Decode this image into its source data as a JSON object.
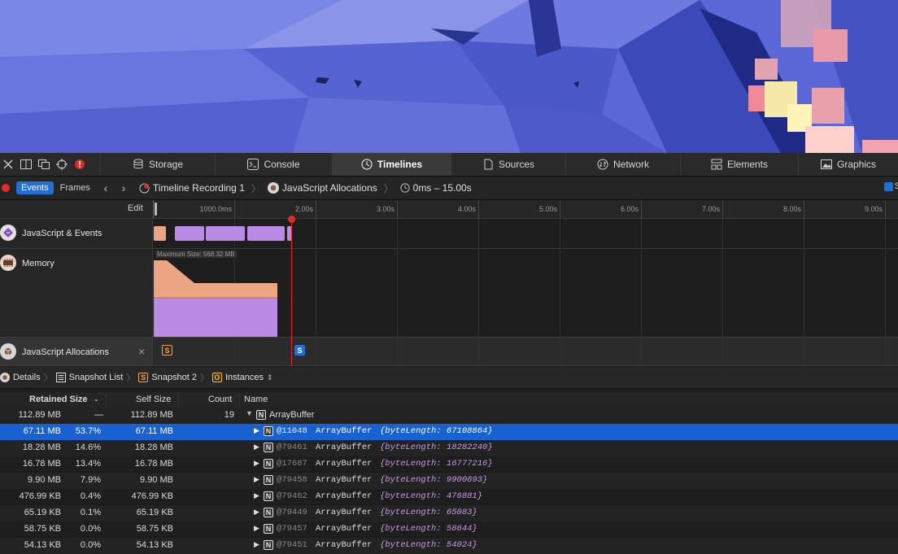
{
  "tabs": [
    {
      "label": "Storage",
      "icon": "storage-icon",
      "active": false
    },
    {
      "label": "Console",
      "icon": "console-icon",
      "active": false
    },
    {
      "label": "Timelines",
      "icon": "timelines-icon",
      "active": true
    },
    {
      "label": "Sources",
      "icon": "sources-icon",
      "active": false
    },
    {
      "label": "Network",
      "icon": "network-icon",
      "active": false
    },
    {
      "label": "Elements",
      "icon": "elements-icon",
      "active": false
    },
    {
      "label": "Graphics",
      "icon": "graphics-icon",
      "active": false
    }
  ],
  "nav": {
    "events": "Events",
    "frames": "Frames",
    "recording": "Timeline Recording 1",
    "instrument": "JavaScript Allocations",
    "range": "0ms – 15.00s",
    "checkbox_label": "S"
  },
  "ruler": {
    "edit": "Edit",
    "ticks": [
      "1000.0ms",
      "2.00s",
      "3.00s",
      "4.00s",
      "5.00s",
      "6.00s",
      "7.00s",
      "8.00s",
      "9.00s"
    ]
  },
  "lanes": {
    "js_events": "JavaScript & Events",
    "memory": "Memory",
    "memory_max": "Maximum Size: 568.32 MB",
    "allocations": "JavaScript Allocations",
    "snapshot_markers": [
      "S",
      "S"
    ]
  },
  "snapshot_bar": {
    "details": "Details",
    "list": "Snapshot List",
    "snapshot": "Snapshot 2",
    "snapshot_badge": "S",
    "instances": "Instances",
    "instances_badge": "O"
  },
  "table": {
    "headers": {
      "retained": "Retained Size",
      "self": "Self Size",
      "count": "Count",
      "name": "Name"
    },
    "group": {
      "retained": "112.89 MB",
      "percent": "—",
      "self": "112.89 MB",
      "count": "19",
      "badge": "N",
      "name": "ArrayBuffer"
    },
    "rows": [
      {
        "retained": "67.11 MB",
        "percent": "53.7%",
        "self": "67.11 MB",
        "id": "@11048",
        "cls": "ArrayBuffer",
        "prop": "{byteLength: 67108864}",
        "selected": true
      },
      {
        "retained": "18.28 MB",
        "percent": "14.6%",
        "self": "18.28 MB",
        "id": "@79461",
        "cls": "ArrayBuffer",
        "prop": "{byteLength: 18282240}",
        "selected": false
      },
      {
        "retained": "16.78 MB",
        "percent": "13.4%",
        "self": "16.78 MB",
        "id": "@17687",
        "cls": "ArrayBuffer",
        "prop": "{byteLength: 16777216}",
        "selected": false
      },
      {
        "retained": "9.90 MB",
        "percent": "7.9%",
        "self": "9.90 MB",
        "id": "@79458",
        "cls": "ArrayBuffer",
        "prop": "{byteLength: 9900693}",
        "selected": false
      },
      {
        "retained": "476.99 KB",
        "percent": "0.4%",
        "self": "476.99 KB",
        "id": "@79462",
        "cls": "ArrayBuffer",
        "prop": "{byteLength: 476881}",
        "selected": false
      },
      {
        "retained": "65.19 KB",
        "percent": "0.1%",
        "self": "65.19 KB",
        "id": "@79449",
        "cls": "ArrayBuffer",
        "prop": "{byteLength: 65083}",
        "selected": false
      },
      {
        "retained": "58.75 KB",
        "percent": "0.0%",
        "self": "58.75 KB",
        "id": "@79457",
        "cls": "ArrayBuffer",
        "prop": "{byteLength: 58644}",
        "selected": false
      },
      {
        "retained": "54.13 KB",
        "percent": "0.0%",
        "self": "54.13 KB",
        "id": "@79451",
        "cls": "ArrayBuffer",
        "prop": "{byteLength: 54024}",
        "selected": false
      }
    ]
  },
  "colors": {
    "accent": "#1f6fd6",
    "script_bar": "#b98be4",
    "layout_bar": "#eba582",
    "record": "#e62b2b"
  }
}
